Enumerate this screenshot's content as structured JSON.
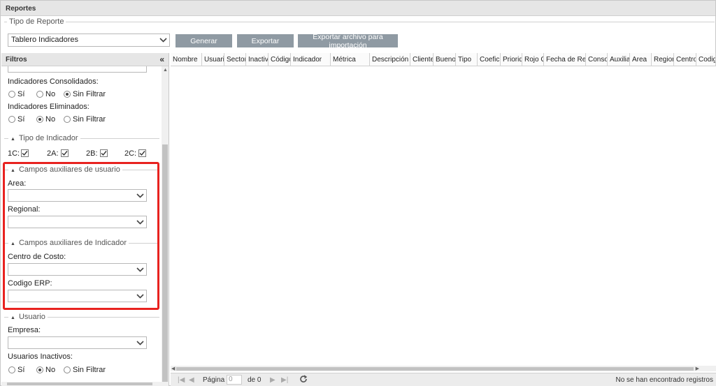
{
  "window": {
    "title": "Reportes"
  },
  "report": {
    "legend": "Tipo de Reporte",
    "type_value": "Tablero Indicadores",
    "buttons": {
      "generate": "Generar",
      "export": "Exportar",
      "export_import": "Exportar archivo para importación"
    }
  },
  "filters": {
    "title": "Filtros",
    "collapse_glyph": "«",
    "consolidated": {
      "label": "Indicadores Consolidados:",
      "options": [
        "Sí",
        "No",
        "Sin Filtrar"
      ],
      "selected": "Sin Filtrar"
    },
    "deleted": {
      "label": "Indicadores Eliminados:",
      "options": [
        "Sí",
        "No",
        "Sin Filtrar"
      ],
      "selected": "No"
    },
    "indicator_type": {
      "title": "Tipo de Indicador",
      "items": [
        "1C:",
        "2A:",
        "2B:",
        "2C:"
      ]
    },
    "user_aux": {
      "title": "Campos auxiliares de usuario",
      "area_label": "Area:",
      "regional_label": "Regional:"
    },
    "indicator_aux": {
      "title": "Campos auxiliares de Indicador",
      "cost_center_label": "Centro de Costo:",
      "erp_label": "Codigo ERP:"
    },
    "user": {
      "title": "Usuario",
      "company_label": "Empresa:",
      "inactive": {
        "label": "Usuarios Inactivos:",
        "options": [
          "Sí",
          "No",
          "Sin Filtrar"
        ],
        "selected": "No"
      }
    }
  },
  "grid": {
    "columns": [
      "Nombre",
      "Usuario",
      "Sector",
      "Inactivo",
      "Código",
      "Indicador",
      "Métrica",
      "Descripción",
      "Cliente",
      "Bueno",
      "Tipo",
      "Coeficiente",
      "Prioridad",
      "Rojo Crítico",
      "Fecha de Registro",
      "Consolidado",
      "Auxiliar",
      "Area",
      "Regional",
      "Centro",
      "Codigo"
    ],
    "pager": {
      "page_label": "Página",
      "page_value": "0",
      "of_label": "de 0",
      "status": "No se han encontrado registros"
    }
  },
  "colors": {
    "highlight": "#e8221f",
    "button": "#8f9aa3"
  }
}
